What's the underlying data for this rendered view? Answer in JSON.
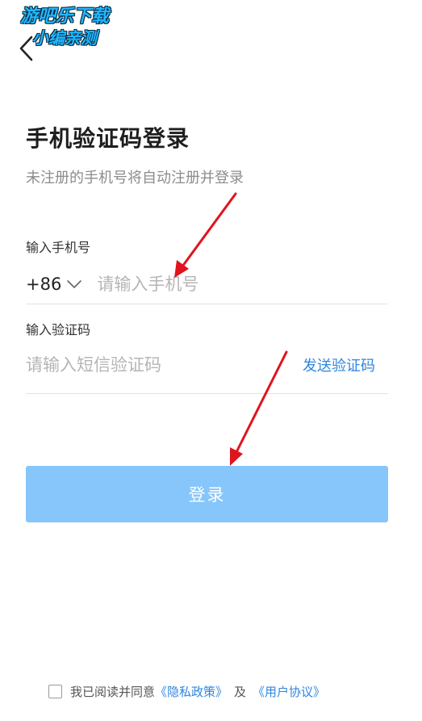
{
  "watermark": {
    "line1": "游吧乐下载",
    "line2": "小编亲测"
  },
  "header": {
    "back_icon": "chevron-left-icon"
  },
  "page": {
    "title": "手机验证码登录",
    "subtitle": "未注册的手机号将自动注册并登录"
  },
  "phone": {
    "label": "输入手机号",
    "country_code": "+86",
    "placeholder": "请输入手机号",
    "value": ""
  },
  "code": {
    "label": "输入验证码",
    "placeholder": "请输入短信验证码",
    "value": "",
    "send_label": "发送验证码"
  },
  "login": {
    "label": "登录"
  },
  "agreement": {
    "checked": false,
    "prefix": "我已阅读并同意",
    "privacy_link": "《隐私政策》",
    "and": "及",
    "terms_link": "《用户协议》"
  },
  "colors": {
    "accent": "#2f86e0",
    "button_disabled": "#86c6fb",
    "annotation_arrow": "#e0141e"
  }
}
